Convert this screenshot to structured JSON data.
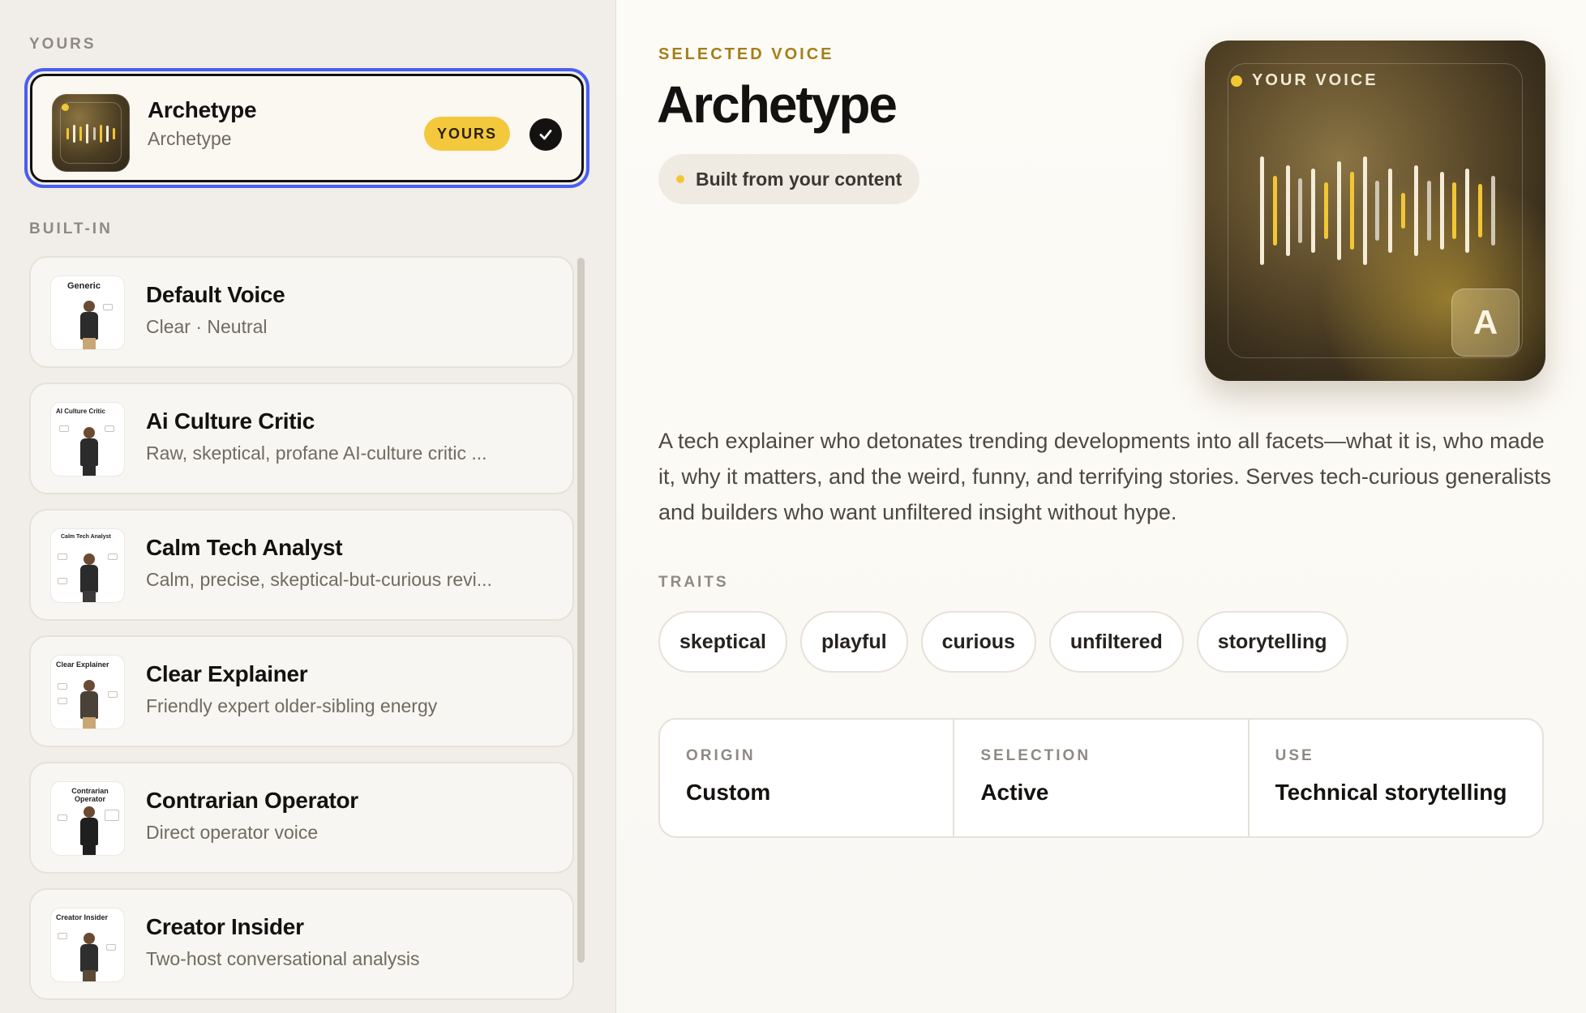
{
  "sidebar": {
    "yours_section_label": "YOURS",
    "builtin_section_label": "BUILT-IN",
    "yours_card": {
      "title": "Archetype",
      "subtitle": "Archetype",
      "badge": "YOURS",
      "selected": true
    },
    "voices": [
      {
        "title": "Default Voice",
        "subtitle": "Clear · Neutral",
        "thumb_label": "Generic"
      },
      {
        "title": "Ai Culture Critic",
        "subtitle": "Raw, skeptical, profane AI-culture critic ...",
        "thumb_label": "AI Culture Critic"
      },
      {
        "title": "Calm Tech Analyst",
        "subtitle": "Calm, precise, skeptical-but-curious revi...",
        "thumb_label": "Calm Tech Analyst"
      },
      {
        "title": "Clear Explainer",
        "subtitle": "Friendly expert older-sibling energy",
        "thumb_label": "Clear Explainer"
      },
      {
        "title": "Contrarian Operator",
        "subtitle": "Direct operator voice",
        "thumb_label": "Contrarian Operator"
      },
      {
        "title": "Creator Insider",
        "subtitle": "Two-host conversational analysis",
        "thumb_label": "Creator Insider"
      }
    ]
  },
  "detail": {
    "eyebrow": "SELECTED VOICE",
    "title": "Archetype",
    "source_pill": "Built from your content",
    "art": {
      "label": "YOUR VOICE",
      "letter": "A"
    },
    "description": "A tech explainer who detonates trending developments into all facets—what it is, who made it, why it matters, and the weird, funny, and terrifying stories. Serves tech-curious generalists and builders who want unfiltered insight without hype.",
    "traits_label": "TRAITS",
    "traits": [
      "skeptical",
      "playful",
      "curious",
      "unfiltered",
      "storytelling"
    ],
    "meta": [
      {
        "key": "ORIGIN",
        "value": "Custom"
      },
      {
        "key": "SELECTION",
        "value": "Active"
      },
      {
        "key": "USE",
        "value": "Technical storytelling"
      }
    ]
  },
  "colors": {
    "accent_yellow": "#f2c735",
    "selection_blue": "#4a5ef0",
    "eyebrow_gold": "#a67e17"
  }
}
